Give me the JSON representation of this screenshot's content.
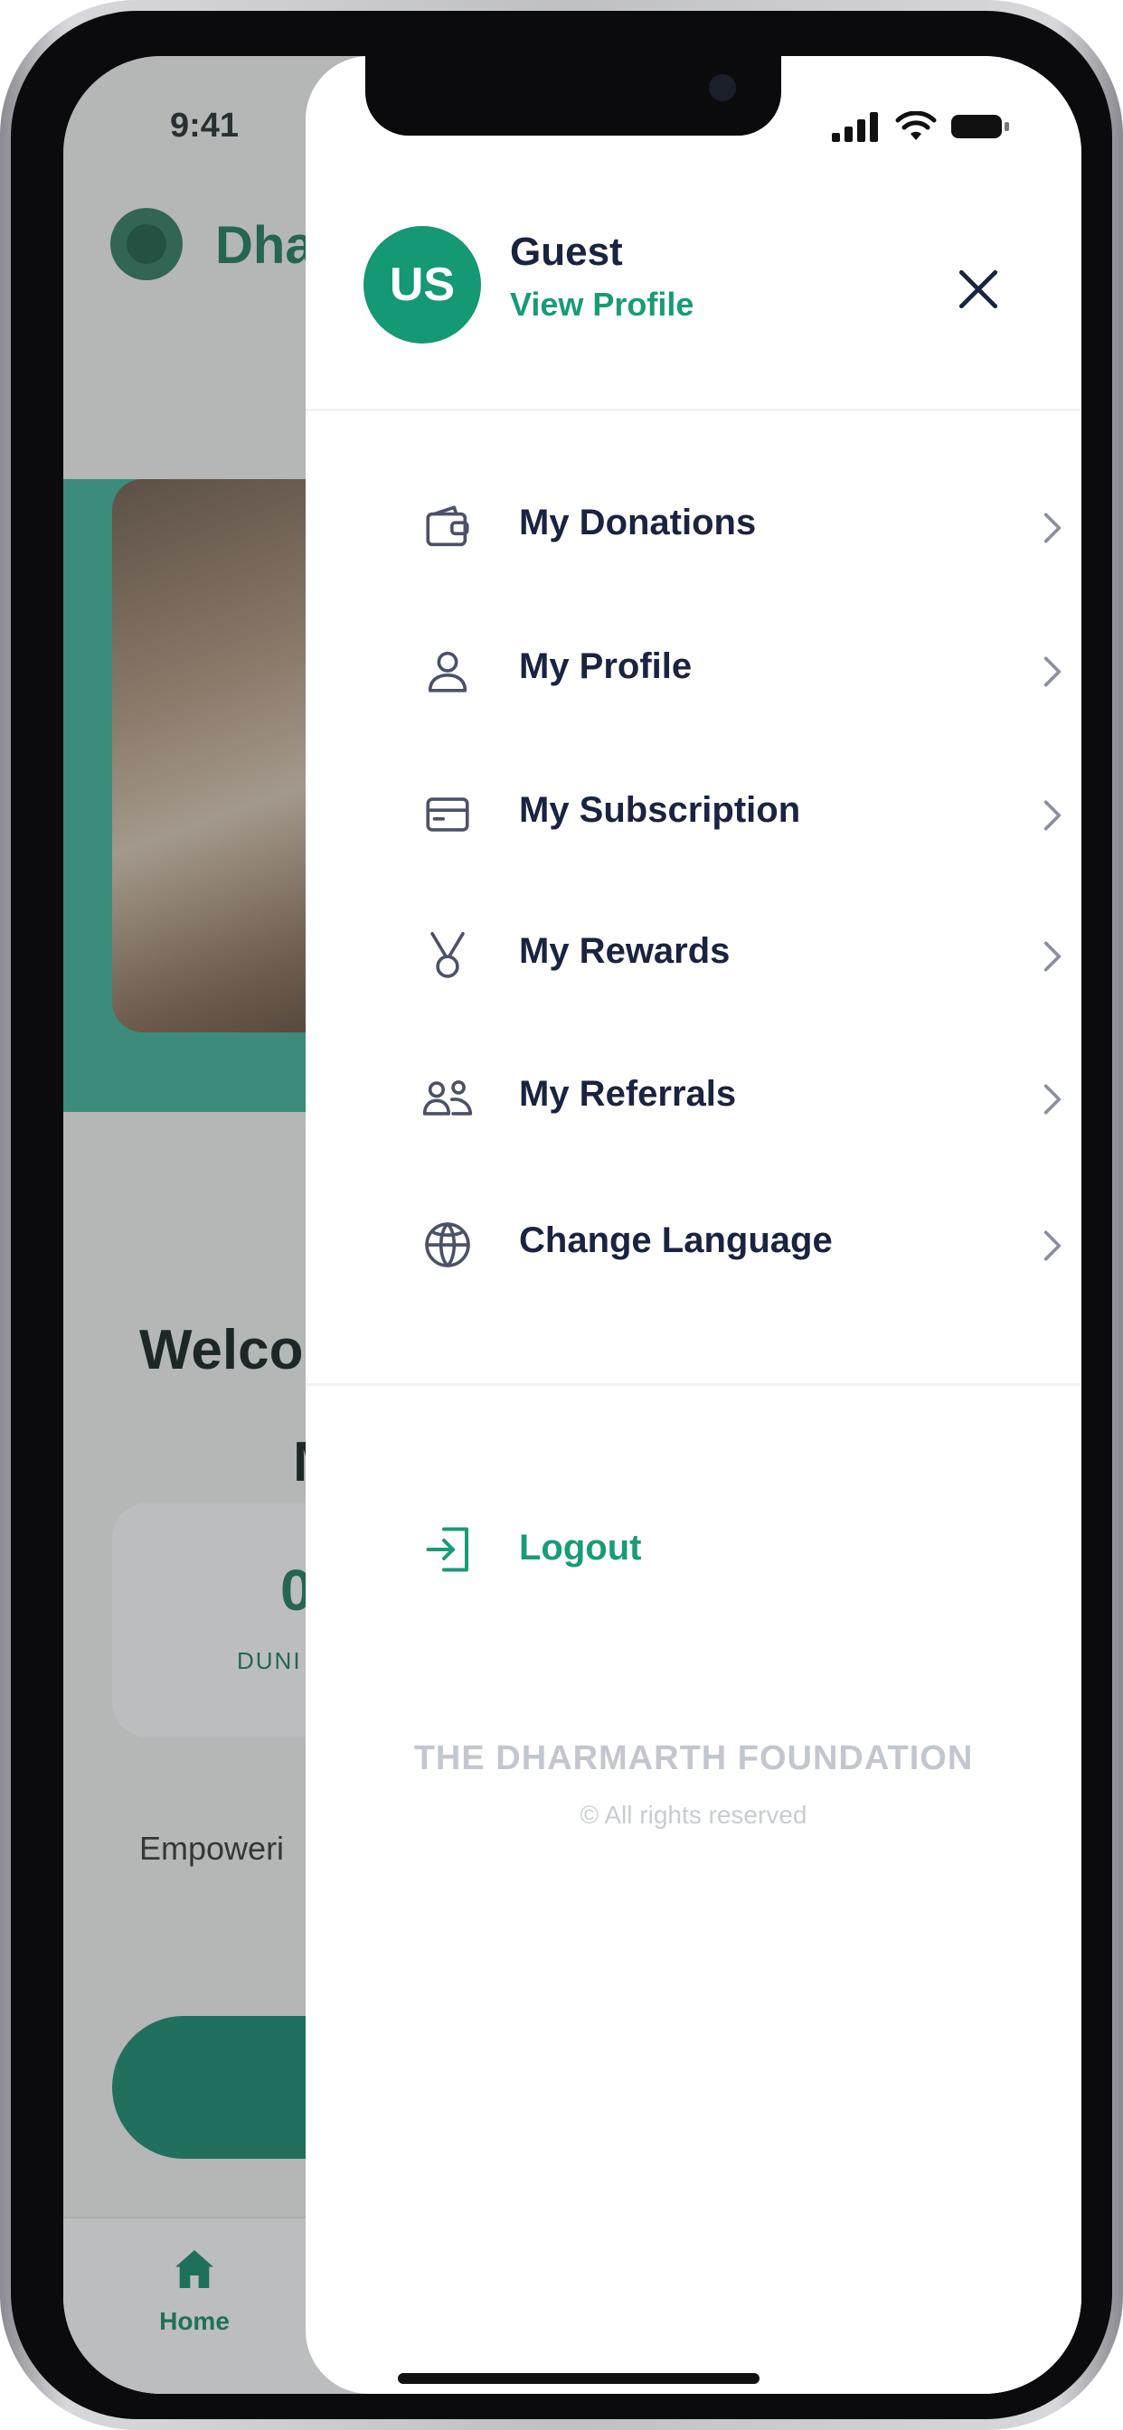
{
  "status_bar": {
    "time": "9:41"
  },
  "background_app": {
    "brand": "Dha",
    "welcome_line1": "Welco",
    "welcome_line2": "Mr",
    "stat_value": "0",
    "stat_label": "DUNI",
    "tagline": "Empoweri",
    "tab_home_label": "Home"
  },
  "drawer": {
    "avatar_initials": "US",
    "user_name": "Guest",
    "view_profile": "View Profile",
    "menu_items": [
      {
        "label": "My Donations",
        "icon": "wallet-icon"
      },
      {
        "label": "My Profile",
        "icon": "user-icon"
      },
      {
        "label": "My Subscription",
        "icon": "card-icon"
      },
      {
        "label": "My Rewards",
        "icon": "rewards-icon"
      },
      {
        "label": "My Referrals",
        "icon": "referrals-icon"
      },
      {
        "label": "Change Language",
        "icon": "globe-icon"
      }
    ],
    "logout_label": "Logout",
    "footer_title": "THE DHARMARTH FOUNDATION",
    "footer_rights": "© All rights reserved"
  },
  "colors": {
    "accent": "#159874",
    "text_primary": "#1a2340",
    "footer_text": "#c2c7cf"
  }
}
